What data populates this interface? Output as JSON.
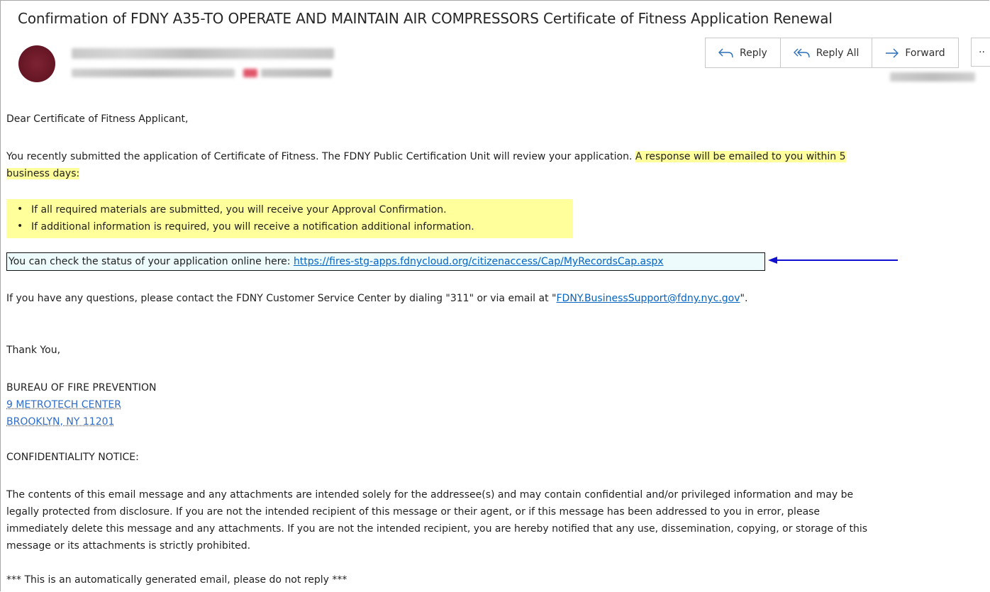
{
  "email": {
    "subject": "Confirmation of FDNY A35-TO OPERATE AND MAINTAIN AIR COMPRESSORS Certificate of Fitness Application Renewal"
  },
  "actions": {
    "reply": "Reply",
    "reply_all": "Reply All",
    "forward": "Forward",
    "more": "··"
  },
  "body": {
    "greeting": "Dear Certificate of Fitness Applicant,",
    "para1_plain": "You recently submitted the application of Certificate of Fitness. The FDNY Public Certification Unit will review your application. ",
    "para1_highlight_line1": "A response will be emailed to you within 5",
    "para1_highlight_line2": "business days:",
    "bullets": [
      "If all required materials are submitted, you will receive your Approval Confirmation.",
      "If additional information is required, you will receive a notification additional information."
    ],
    "status_text": "You can check the status of your application online here: ",
    "status_link": "https://fires-stg-apps.fdnycloud.org/citizenaccess/Cap/MyRecordsCap.aspx",
    "questions_text": "If you have any questions, please contact the FDNY Customer Service Center by dialing \"311\" or via email at \"",
    "questions_email": "FDNY.BusinessSupport@fdny.nyc.gov",
    "questions_end": "\".",
    "thanks": "Thank You,",
    "org": "BUREAU OF FIRE PREVENTION",
    "addr1": "9 METROTECH CENTER",
    "addr2": "BROOKLYN, NY 11201",
    "conf_heading": "CONFIDENTIALITY NOTICE:",
    "conf_lines": [
      "The contents of this email message and any attachments are intended solely for the addressee(s) and may contain confidential and/or privileged information and may be",
      "legally protected from disclosure. If you are not the intended recipient of this message or their agent, or if this message has been addressed to you in error, please",
      "immediately delete this message and any attachments. If you are not the intended recipient, you are hereby notified that any use, dissemination, copying, or storage of this",
      "message or its attachments is strictly prohibited."
    ],
    "auto_notice": "*** This is an automatically generated email, please do not reply ***"
  },
  "colors": {
    "highlight": "#ffff9b",
    "link": "#0563c1",
    "arrow": "#1010d0",
    "status_box_bg": "#eefbfd"
  }
}
